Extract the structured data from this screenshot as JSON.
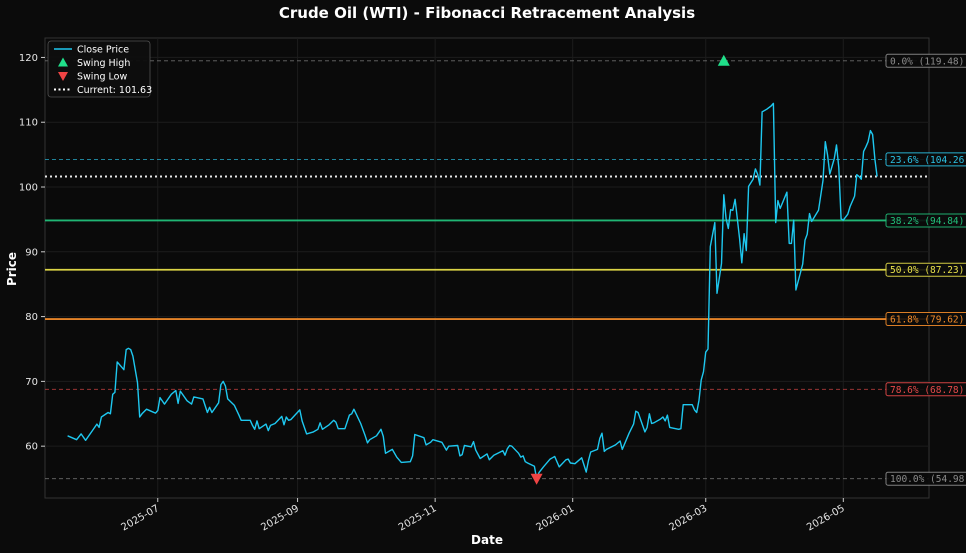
{
  "chart_data": {
    "type": "line",
    "title": "Crude Oil (WTI) - Fibonacci Retracement Analysis",
    "xlabel": "Date",
    "ylabel": "Price",
    "ylim": [
      52,
      123
    ],
    "xlim": [
      "2025-05-12",
      "2026-06-08"
    ],
    "x_ticks": [
      {
        "label": "2025-07",
        "date": "2025-07-01"
      },
      {
        "label": "2025-09",
        "date": "2025-09-01"
      },
      {
        "label": "2025-11",
        "date": "2025-11-01"
      },
      {
        "label": "2026-01",
        "date": "2026-01-01"
      },
      {
        "label": "2026-03",
        "date": "2026-03-01"
      },
      {
        "label": "2026-05",
        "date": "2026-05-01"
      }
    ],
    "y_ticks": [
      60,
      70,
      80,
      90,
      100,
      110,
      120
    ],
    "grid": true,
    "legend_position": "top-left",
    "legend": [
      {
        "label": "Close Price",
        "kind": "line",
        "color": "#1ec8f0"
      },
      {
        "label": "Swing High",
        "kind": "triangle-up",
        "color": "#20e08a"
      },
      {
        "label": "Swing Low",
        "kind": "triangle-down",
        "color": "#ef4444"
      },
      {
        "label": "Current: 101.63",
        "kind": "dotted",
        "color": "#ffffff"
      }
    ],
    "series": [
      {
        "name": "Close Price",
        "color": "#1ec8f0",
        "points": [
          [
            "2025-05-22",
            61.6
          ],
          [
            "2025-05-26",
            61.0
          ],
          [
            "2025-05-28",
            61.9
          ],
          [
            "2025-05-30",
            60.9
          ],
          [
            "2025-06-02",
            62.4
          ],
          [
            "2025-06-04",
            63.4
          ],
          [
            "2025-06-05",
            62.9
          ],
          [
            "2025-06-06",
            64.5
          ],
          [
            "2025-06-09",
            65.2
          ],
          [
            "2025-06-10",
            65.0
          ],
          [
            "2025-06-11",
            68.0
          ],
          [
            "2025-06-12",
            68.3
          ],
          [
            "2025-06-13",
            73.0
          ],
          [
            "2025-06-16",
            71.8
          ],
          [
            "2025-06-17",
            74.9
          ],
          [
            "2025-06-18",
            75.1
          ],
          [
            "2025-06-19",
            74.9
          ],
          [
            "2025-06-20",
            73.9
          ],
          [
            "2025-06-22",
            69.8
          ],
          [
            "2025-06-23",
            64.5
          ],
          [
            "2025-06-24",
            65.0
          ],
          [
            "2025-06-26",
            65.7
          ],
          [
            "2025-06-28",
            65.4
          ],
          [
            "2025-06-30",
            65.1
          ],
          [
            "2025-07-01",
            65.5
          ],
          [
            "2025-07-02",
            67.5
          ],
          [
            "2025-07-04",
            66.5
          ],
          [
            "2025-07-07",
            68.0
          ],
          [
            "2025-07-09",
            68.6
          ],
          [
            "2025-07-10",
            66.6
          ],
          [
            "2025-07-11",
            68.5
          ],
          [
            "2025-07-14",
            67.0
          ],
          [
            "2025-07-16",
            66.5
          ],
          [
            "2025-07-17",
            67.6
          ],
          [
            "2025-07-21",
            67.3
          ],
          [
            "2025-07-23",
            65.2
          ],
          [
            "2025-07-24",
            66.0
          ],
          [
            "2025-07-25",
            65.2
          ],
          [
            "2025-07-28",
            66.7
          ],
          [
            "2025-07-29",
            69.5
          ],
          [
            "2025-07-30",
            70.0
          ],
          [
            "2025-07-31",
            69.3
          ],
          [
            "2025-08-01",
            67.3
          ],
          [
            "2025-08-04",
            66.3
          ],
          [
            "2025-08-06",
            64.8
          ],
          [
            "2025-08-07",
            64.0
          ],
          [
            "2025-08-11",
            64.0
          ],
          [
            "2025-08-12",
            63.2
          ],
          [
            "2025-08-13",
            62.6
          ],
          [
            "2025-08-14",
            63.9
          ],
          [
            "2025-08-15",
            62.7
          ],
          [
            "2025-08-18",
            63.4
          ],
          [
            "2025-08-19",
            62.4
          ],
          [
            "2025-08-20",
            63.2
          ],
          [
            "2025-08-22",
            63.5
          ],
          [
            "2025-08-25",
            64.6
          ],
          [
            "2025-08-26",
            63.3
          ],
          [
            "2025-08-27",
            64.5
          ],
          [
            "2025-08-28",
            64.0
          ],
          [
            "2025-08-29",
            64.1
          ],
          [
            "2025-09-02",
            65.6
          ],
          [
            "2025-09-03",
            63.9
          ],
          [
            "2025-09-05",
            61.9
          ],
          [
            "2025-09-08",
            62.2
          ],
          [
            "2025-09-10",
            62.6
          ],
          [
            "2025-09-11",
            63.6
          ],
          [
            "2025-09-12",
            62.6
          ],
          [
            "2025-09-15",
            63.3
          ],
          [
            "2025-09-17",
            64.0
          ],
          [
            "2025-09-18",
            63.7
          ],
          [
            "2025-09-19",
            62.7
          ],
          [
            "2025-09-22",
            62.7
          ],
          [
            "2025-09-24",
            64.8
          ],
          [
            "2025-09-25",
            65.0
          ],
          [
            "2025-09-26",
            65.7
          ],
          [
            "2025-09-29",
            63.5
          ],
          [
            "2025-10-01",
            61.6
          ],
          [
            "2025-10-02",
            60.5
          ],
          [
            "2025-10-03",
            61.0
          ],
          [
            "2025-10-06",
            61.6
          ],
          [
            "2025-10-08",
            62.6
          ],
          [
            "2025-10-09",
            61.5
          ],
          [
            "2025-10-10",
            58.9
          ],
          [
            "2025-10-13",
            59.5
          ],
          [
            "2025-10-15",
            58.3
          ],
          [
            "2025-10-17",
            57.5
          ],
          [
            "2025-10-21",
            57.6
          ],
          [
            "2025-10-22",
            58.5
          ],
          [
            "2025-10-23",
            61.8
          ],
          [
            "2025-10-27",
            61.3
          ],
          [
            "2025-10-28",
            60.2
          ],
          [
            "2025-10-30",
            60.6
          ],
          [
            "2025-10-31",
            61.0
          ],
          [
            "2025-11-04",
            60.6
          ],
          [
            "2025-11-06",
            59.4
          ],
          [
            "2025-11-07",
            60.0
          ],
          [
            "2025-11-11",
            60.1
          ],
          [
            "2025-11-12",
            58.5
          ],
          [
            "2025-11-13",
            58.7
          ],
          [
            "2025-11-14",
            60.1
          ],
          [
            "2025-11-17",
            59.9
          ],
          [
            "2025-11-18",
            60.7
          ],
          [
            "2025-11-19",
            59.4
          ],
          [
            "2025-11-21",
            58.1
          ],
          [
            "2025-11-24",
            58.8
          ],
          [
            "2025-11-25",
            57.9
          ],
          [
            "2025-11-27",
            58.6
          ],
          [
            "2025-12-01",
            59.3
          ],
          [
            "2025-12-02",
            58.6
          ],
          [
            "2025-12-03",
            59.6
          ],
          [
            "2025-12-04",
            60.1
          ],
          [
            "2025-12-05",
            60.0
          ],
          [
            "2025-12-08",
            58.9
          ],
          [
            "2025-12-09",
            58.3
          ],
          [
            "2025-12-10",
            58.5
          ],
          [
            "2025-12-11",
            57.6
          ],
          [
            "2025-12-12",
            57.4
          ],
          [
            "2025-12-15",
            56.9
          ],
          [
            "2025-12-16",
            54.98
          ],
          [
            "2025-12-17",
            55.9
          ],
          [
            "2025-12-19",
            56.8
          ],
          [
            "2025-12-22",
            58.0
          ],
          [
            "2025-12-23",
            58.2
          ],
          [
            "2025-12-24",
            58.4
          ],
          [
            "2025-12-26",
            56.8
          ],
          [
            "2025-12-29",
            57.9
          ],
          [
            "2025-12-30",
            58.0
          ],
          [
            "2025-12-31",
            57.4
          ],
          [
            "2026-01-02",
            57.3
          ],
          [
            "2026-01-05",
            58.2
          ],
          [
            "2026-01-06",
            57.1
          ],
          [
            "2026-01-07",
            56.0
          ],
          [
            "2026-01-08",
            57.8
          ],
          [
            "2026-01-09",
            59.1
          ],
          [
            "2026-01-12",
            59.5
          ],
          [
            "2026-01-13",
            61.2
          ],
          [
            "2026-01-14",
            62.0
          ],
          [
            "2026-01-15",
            59.2
          ],
          [
            "2026-01-16",
            59.5
          ],
          [
            "2026-01-20",
            60.2
          ],
          [
            "2026-01-22",
            60.8
          ],
          [
            "2026-01-23",
            59.5
          ],
          [
            "2026-01-26",
            62.0
          ],
          [
            "2026-01-28",
            63.4
          ],
          [
            "2026-01-29",
            65.4
          ],
          [
            "2026-01-30",
            65.2
          ],
          [
            "2026-02-02",
            62.2
          ],
          [
            "2026-02-03",
            62.9
          ],
          [
            "2026-02-04",
            65.0
          ],
          [
            "2026-02-05",
            63.5
          ],
          [
            "2026-02-06",
            63.6
          ],
          [
            "2026-02-09",
            64.2
          ],
          [
            "2026-02-10",
            64.5
          ],
          [
            "2026-02-11",
            63.9
          ],
          [
            "2026-02-12",
            64.8
          ],
          [
            "2026-02-13",
            62.9
          ],
          [
            "2026-02-17",
            62.6
          ],
          [
            "2026-02-18",
            62.7
          ],
          [
            "2026-02-19",
            66.4
          ],
          [
            "2026-02-23",
            66.4
          ],
          [
            "2026-02-24",
            65.6
          ],
          [
            "2026-02-25",
            65.2
          ],
          [
            "2026-02-26",
            67.1
          ],
          [
            "2026-02-27",
            70.2
          ],
          [
            "2026-02-28",
            71.5
          ],
          [
            "2026-03-01",
            74.5
          ],
          [
            "2026-03-02",
            75.0
          ],
          [
            "2026-03-03",
            90.8
          ],
          [
            "2026-03-05",
            94.5
          ],
          [
            "2026-03-06",
            83.6
          ],
          [
            "2026-03-08",
            88.2
          ],
          [
            "2026-03-09",
            98.8
          ],
          [
            "2026-03-10",
            95.2
          ],
          [
            "2026-03-11",
            93.6
          ],
          [
            "2026-03-12",
            96.5
          ],
          [
            "2026-03-13",
            96.4
          ],
          [
            "2026-03-14",
            98.1
          ],
          [
            "2026-03-16",
            92.0
          ],
          [
            "2026-03-17",
            88.3
          ],
          [
            "2026-03-18",
            92.8
          ],
          [
            "2026-03-19",
            90.2
          ],
          [
            "2026-03-20",
            100.1
          ],
          [
            "2026-03-22",
            101.2
          ],
          [
            "2026-03-23",
            102.8
          ],
          [
            "2026-03-24",
            102.0
          ],
          [
            "2026-03-25",
            100.3
          ],
          [
            "2026-03-26",
            111.6
          ],
          [
            "2026-03-28",
            112.0
          ],
          [
            "2026-03-30",
            112.5
          ],
          [
            "2026-03-31",
            112.9
          ],
          [
            "2026-04-01",
            94.5
          ],
          [
            "2026-04-02",
            97.9
          ],
          [
            "2026-04-03",
            96.7
          ],
          [
            "2026-04-06",
            99.2
          ],
          [
            "2026-04-07",
            91.3
          ],
          [
            "2026-04-08",
            91.3
          ],
          [
            "2026-04-09",
            94.9
          ],
          [
            "2026-04-10",
            84.1
          ],
          [
            "2026-04-13",
            88.1
          ],
          [
            "2026-04-14",
            91.8
          ],
          [
            "2026-04-15",
            92.7
          ],
          [
            "2026-04-16",
            95.9
          ],
          [
            "2026-04-17",
            94.7
          ],
          [
            "2026-04-20",
            96.4
          ],
          [
            "2026-04-22",
            101.0
          ],
          [
            "2026-04-23",
            107.0
          ],
          [
            "2026-04-24",
            105.0
          ],
          [
            "2026-04-25",
            102.0
          ],
          [
            "2026-04-27",
            104.4
          ],
          [
            "2026-04-28",
            106.5
          ],
          [
            "2026-04-29",
            103.0
          ],
          [
            "2026-04-30",
            95.1
          ],
          [
            "2026-05-01",
            94.9
          ],
          [
            "2026-05-03",
            95.8
          ],
          [
            "2026-05-04",
            97.0
          ],
          [
            "2026-05-06",
            98.6
          ],
          [
            "2026-05-07",
            101.9
          ],
          [
            "2026-05-08",
            101.6
          ],
          [
            "2026-05-09",
            101.2
          ],
          [
            "2026-05-10",
            105.5
          ],
          [
            "2026-05-11",
            106.2
          ],
          [
            "2026-05-12",
            107.0
          ],
          [
            "2026-05-13",
            108.7
          ],
          [
            "2026-05-14",
            108.1
          ],
          [
            "2026-05-15",
            104.3
          ],
          [
            "2026-05-16",
            101.63
          ]
        ]
      }
    ],
    "swing_high": {
      "date": "2026-03-09",
      "value": 119.48,
      "color": "#20e08a"
    },
    "swing_low": {
      "date": "2025-12-16",
      "value": 54.98,
      "color": "#ef4444"
    },
    "current": {
      "value": 101.63,
      "color": "#ffffff"
    },
    "fib_levels": [
      {
        "label": "0.0% (119.48)",
        "value": 119.48,
        "color": "#8c8c8c",
        "style": "dashed"
      },
      {
        "label": "23.6% (104.26)",
        "value": 104.26,
        "color": "#2cc3e6",
        "style": "dashed"
      },
      {
        "label": "38.2% (94.84)",
        "value": 94.84,
        "color": "#22c07a",
        "style": "solid"
      },
      {
        "label": "50.0% (87.23)",
        "value": 87.23,
        "color": "#e8e04a",
        "style": "solid"
      },
      {
        "label": "61.8% (79.62)",
        "value": 79.62,
        "color": "#f08a2a",
        "style": "solid"
      },
      {
        "label": "78.6% (68.78)",
        "value": 68.78,
        "color": "#e64a4a",
        "style": "dashed"
      },
      {
        "label": "100.0% (54.98)",
        "value": 54.98,
        "color": "#8c8c8c",
        "style": "dashed"
      }
    ]
  }
}
